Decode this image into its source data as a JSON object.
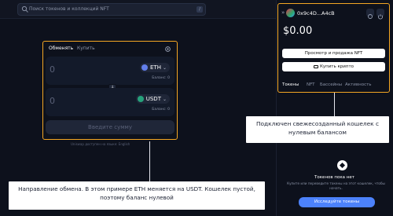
{
  "search": {
    "placeholder": "Поиск токенов и коллекций NFT",
    "shortcut": "/"
  },
  "swap": {
    "tabs": [
      "Обменять",
      "Купить"
    ],
    "from": {
      "amount": "0",
      "token": "ETH",
      "balance": "Баланс: 0"
    },
    "to": {
      "amount": "0",
      "token": "USDT",
      "balance": "Баланс: 0"
    },
    "cta": "Введите сумму",
    "footer_note": "Uniswap доступен на языке: English"
  },
  "wallet": {
    "address": "0x9c4D...A4cB",
    "balance": "$0.00",
    "primary_button": "Просмотр и продажа NFT",
    "secondary_button": "Купить крипто",
    "tabs": [
      "Токены",
      "NFT",
      "Бассейны",
      "Активность"
    ],
    "empty": {
      "title": "Токенов пока нет",
      "subtitle": "Купите или переведите токены на этот кошелек, чтобы начать.",
      "button": "Исследуйте токены"
    }
  },
  "annotations": {
    "left": "Направление обмена. В этом примере ETH меняется на USDT. Кошелек пустой, поэтому баланс нулевой",
    "right": "Подключен свежесозданный кошелек с нулевым балансом"
  },
  "colors": {
    "highlight": "#f4a623",
    "accent": "#4c82fb",
    "background": "#0d111c"
  }
}
